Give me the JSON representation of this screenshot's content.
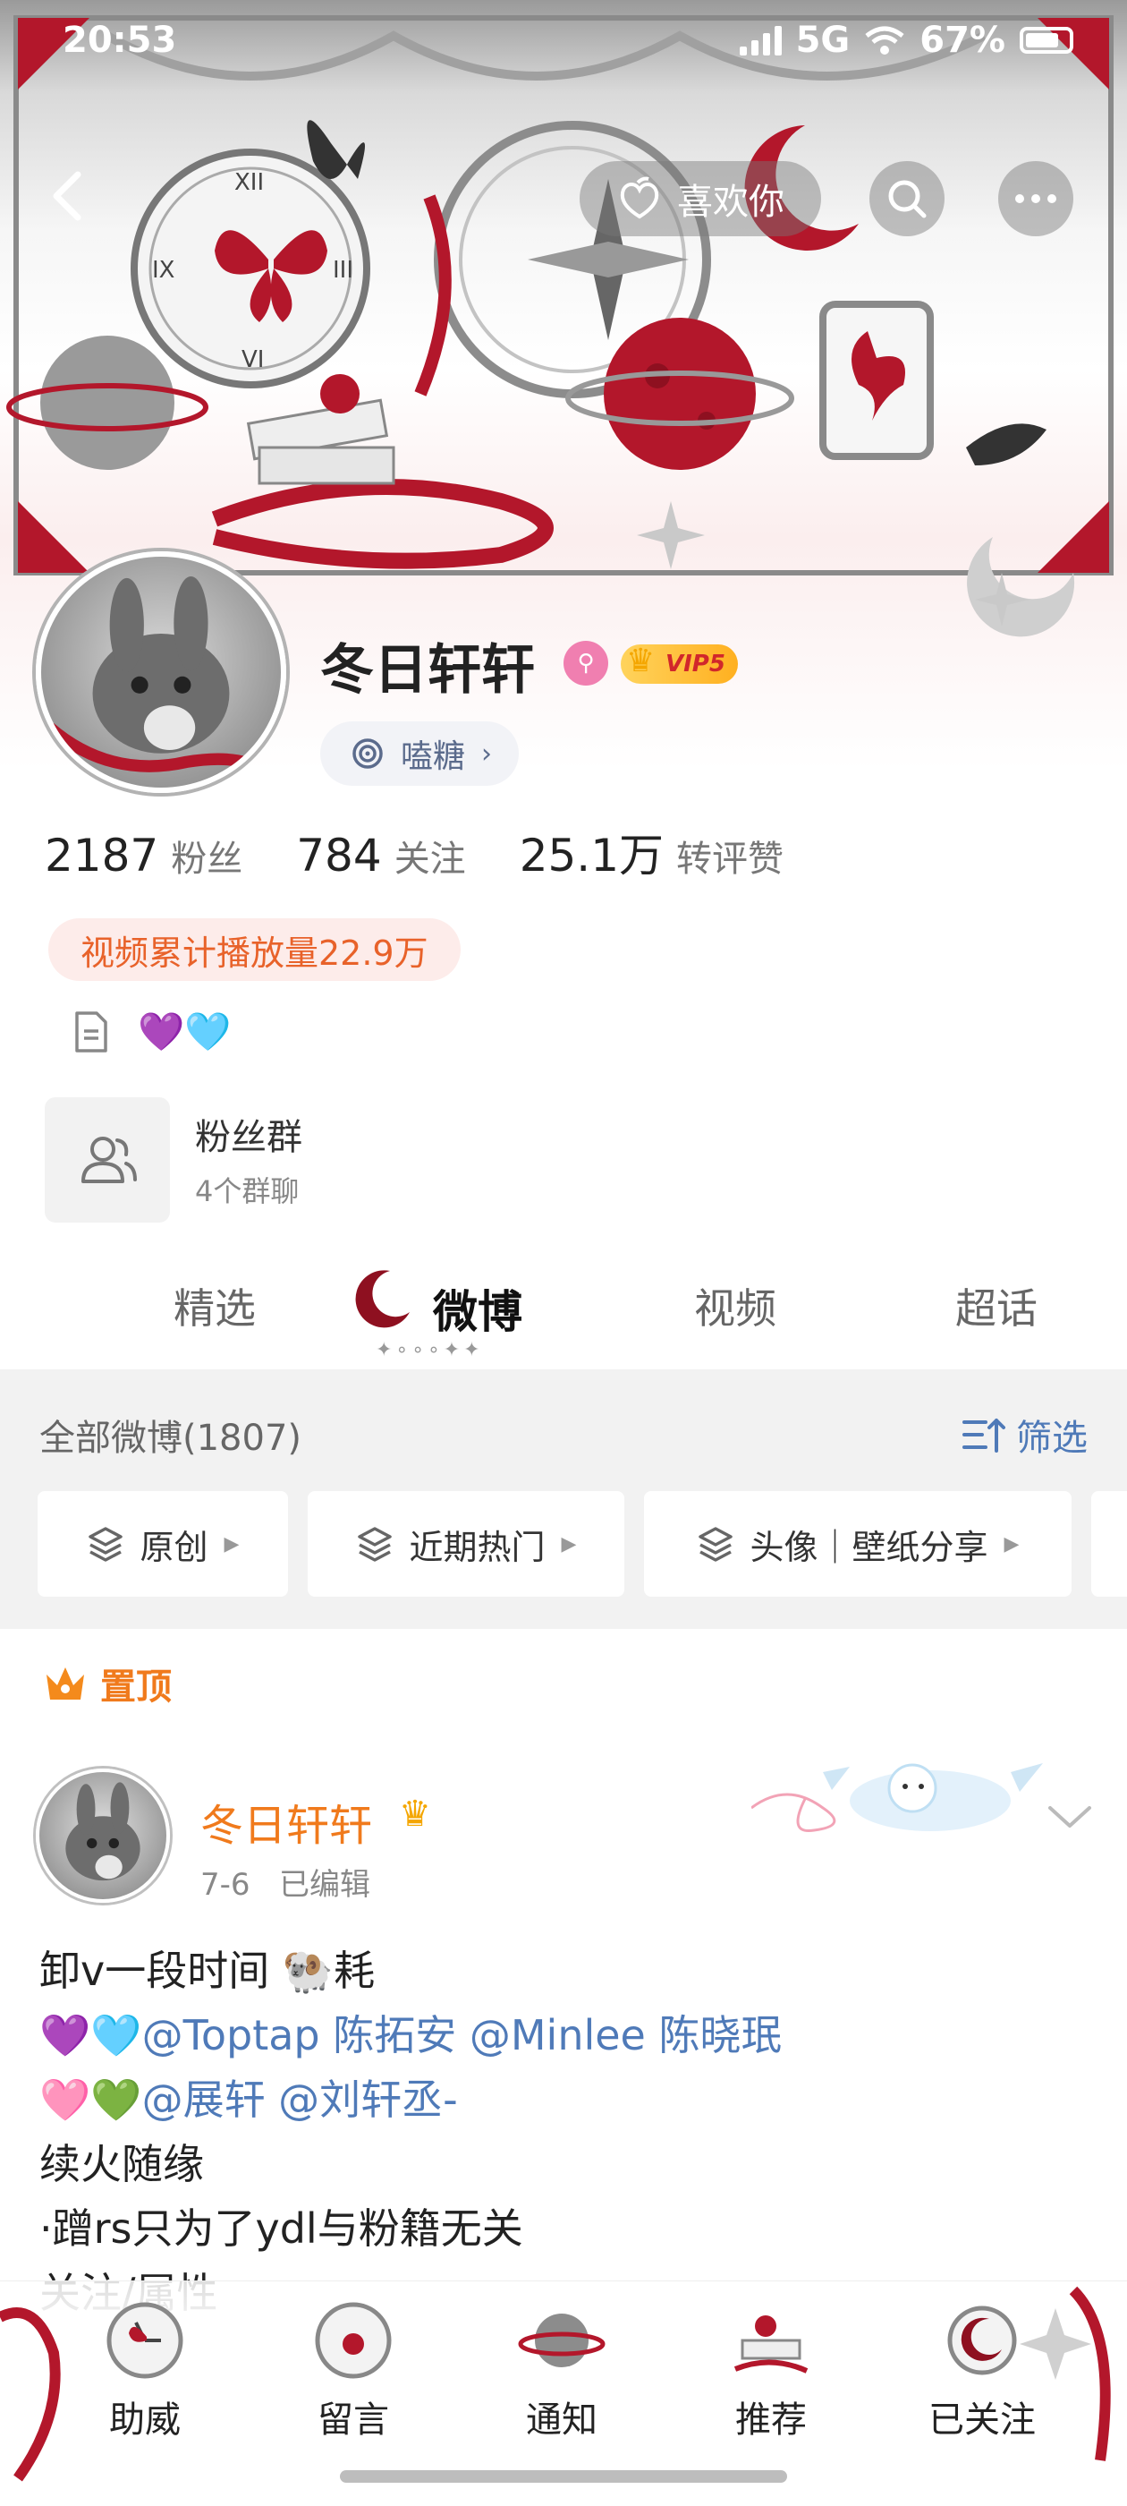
{
  "status_bar": {
    "time": "20:53",
    "network": "5G",
    "battery": "67%"
  },
  "nav": {
    "like_label": "喜欢你"
  },
  "profile": {
    "name": "冬日轩轩",
    "vip_label": "VIP5",
    "tag": "嗑糖",
    "stats": [
      {
        "num": "2187",
        "label": "粉丝"
      },
      {
        "num": "784",
        "label": "关注"
      },
      {
        "num": "25.1万",
        "label": "转评赞"
      }
    ],
    "play_count": "视频累计播放量22.9万",
    "bio_hearts": "💜🩵",
    "group": {
      "title": "粉丝群",
      "subtitle": "4个群聊"
    }
  },
  "tabs": [
    {
      "label": "精选",
      "active": false
    },
    {
      "label": "微博",
      "active": true
    },
    {
      "label": "视频",
      "active": false
    },
    {
      "label": "超话",
      "active": false
    }
  ],
  "tab_deco": "✦∘∘∘✦✦",
  "filter": {
    "title": "全部微博(1807)",
    "button": "筛选",
    "chips": [
      "原创",
      "近期热门",
      "头像｜壁纸分享"
    ]
  },
  "post": {
    "pinned_label": "置顶",
    "author": "冬日轩轩",
    "date": "7-6",
    "edited": "已编辑",
    "lines": [
      {
        "text": "卸v一段时间 🐏耗",
        "mentions": ""
      },
      {
        "text": "💜🩵",
        "mentions": "@Toptap 陈拓安 @Minlee 陈晓珉"
      },
      {
        "text": "🩷💚",
        "mentions": "@展轩 @刘轩丞-"
      },
      {
        "text": "续火随缘",
        "mentions": ""
      },
      {
        "text": "·蹭rs只为了ydl与粉籍无关",
        "mentions": ""
      },
      {
        "text": "关注/属性",
        "mentions": ""
      }
    ]
  },
  "bottom_bar": [
    "助威",
    "留言",
    "通知",
    "推荐",
    "已关注"
  ],
  "colors": {
    "accent_orange": "#f07a1c",
    "link_blue": "#4f7ab8",
    "crimson": "#b3172b"
  }
}
